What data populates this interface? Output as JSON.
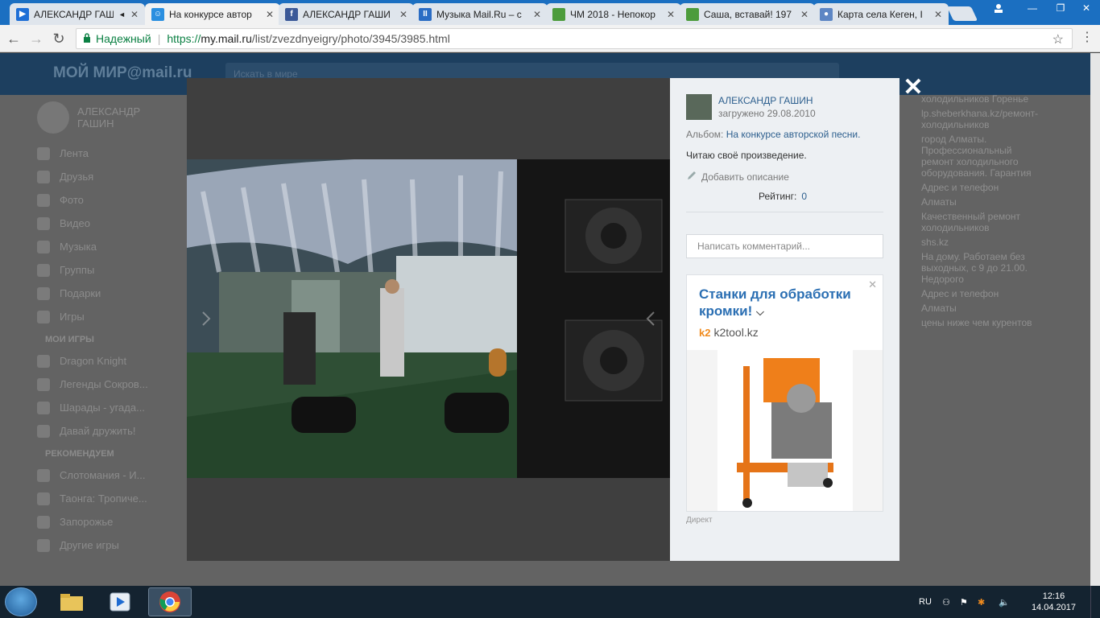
{
  "browser": {
    "tabs": [
      {
        "title": "АЛЕКСАНДР ГАШ",
        "favicon_color": "#1e6fd6",
        "favicon": "▶",
        "muted_icon": true
      },
      {
        "title": "На конкурсе автор",
        "favicon_color": "#2a8fe0",
        "favicon": "☺",
        "active": true
      },
      {
        "title": "АЛЕКСАНДР ГАШИ",
        "favicon_color": "#3b5998",
        "favicon": "f"
      },
      {
        "title": "Музыка Mail.Ru – с",
        "favicon_color": "#2a6cc4",
        "favicon": "II"
      },
      {
        "title": "ЧМ 2018 - Непокор",
        "favicon_color": "#4c9c3c",
        "favicon": ""
      },
      {
        "title": "Саша, вставай! 197",
        "favicon_color": "#4c9c3c",
        "favicon": ""
      },
      {
        "title": "Карта села Кеген, I",
        "favicon_color": "#5d86c4",
        "favicon": "●"
      }
    ],
    "secure_label": "Надежный",
    "url_scheme": "https://",
    "url_host": "my.mail.ru",
    "url_path": "/list/zvezdnyeigry/photo/3945/3985.html"
  },
  "site": {
    "logo": "МОЙ МИР@mail.ru",
    "search_placeholder": "Искать в мире",
    "profile_name": "АЛЕКСАНДР ГАШИН",
    "nav": [
      "Лента",
      "Друзья",
      "Фото",
      "Видео",
      "Музыка",
      "Группы",
      "Подарки",
      "Игры"
    ],
    "my_games_header": "МОИ ИГРЫ",
    "my_games": [
      "Dragon Knight",
      "Легенды Сокров...",
      "Шарады - угада...",
      "Давай дружить!"
    ],
    "recommended_header": "РЕКОМЕНДУЕМ",
    "recommended": [
      "Слотомания - И...",
      "Таонга: Тропиче...",
      "Запорожье",
      "Другие игры"
    ],
    "right_ads": [
      "холодильников Горенье",
      "lp.sheberkhana.kz/ремонт-холодильников",
      "город Алматы. Профессиональный ремонт холодильного оборудования. Гарантия",
      "Адрес и телефон",
      "Алматы",
      "Качественный ремонт холодильников",
      "shs.kz",
      "На дому. Работаем без выходных, с 9 до 21.00. Недорого",
      "Адрес и телефон",
      "Алматы",
      "цены ниже чем курентов"
    ]
  },
  "modal": {
    "author": "АЛЕКСАНДР ГАШИН",
    "uploaded": "загружено 29.08.2010",
    "album_label": "Альбом:",
    "album_name": "На конкурсе авторской песни.",
    "description": "Читаю своё произведение.",
    "add_description": "Добавить описание",
    "rating_label": "Рейтинг:",
    "rating_value": "0",
    "comment_placeholder": "Написать комментарий...",
    "ad": {
      "title": "Станки для обработки кромки!",
      "domain_logo": "k2",
      "domain": "k2tool.kz",
      "label": "Директ"
    }
  },
  "taskbar": {
    "lang": "RU",
    "time": "12:16",
    "date": "14.04.2017"
  }
}
